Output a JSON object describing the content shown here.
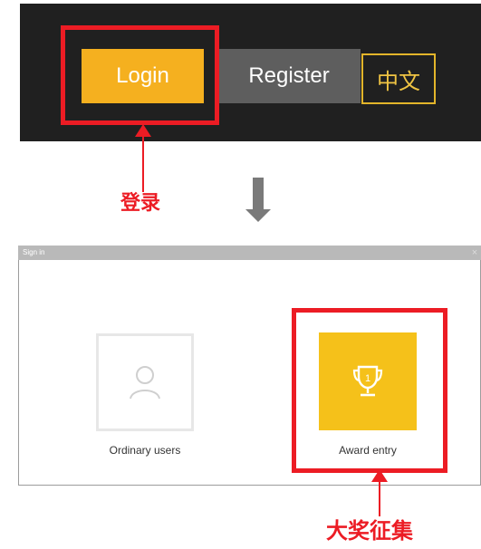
{
  "nav": {
    "login_label": "Login",
    "register_label": "Register",
    "language_label": "中文"
  },
  "annotations": {
    "login_caption": "登录",
    "award_caption": "大奖征集"
  },
  "dialog": {
    "title": "Sign in",
    "close_label": "×",
    "options": [
      {
        "label": "Ordinary users",
        "icon": "user-icon"
      },
      {
        "label": "Award entry",
        "icon": "trophy-icon",
        "icon_text": "1"
      }
    ]
  },
  "colors": {
    "login_button": "#f5b01f",
    "register_button": "#5e5e5e",
    "topbar": "#202020",
    "highlight": "#ec1c24",
    "award_tile": "#f5c11a"
  }
}
